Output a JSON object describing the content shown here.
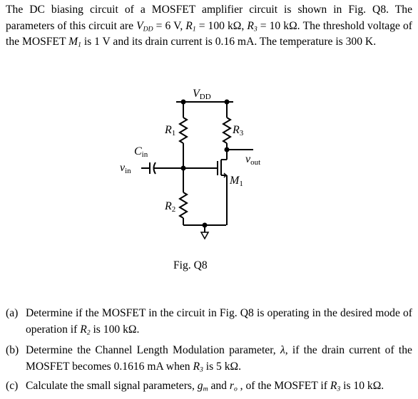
{
  "intro": [
    {
      "t": "The DC biasing circuit of a MOSFET amplifier circuit is shown in Fig. Q8. The parameters of this circuit are "
    },
    {
      "t": "V",
      "i": true
    },
    {
      "t": "DD",
      "i": true,
      "sub": true
    },
    {
      "t": " = 6 V, "
    },
    {
      "t": "R",
      "i": true
    },
    {
      "t": "1",
      "i": true,
      "sub": true
    },
    {
      "t": " = 100 kΩ, "
    },
    {
      "t": "R",
      "i": true
    },
    {
      "t": "3",
      "i": true,
      "sub": true
    },
    {
      "t": " = 10 kΩ. The threshold voltage of the MOSFET "
    },
    {
      "t": "M",
      "i": true
    },
    {
      "t": "1",
      "i": true,
      "sub": true
    },
    {
      "t": " is 1 V and its drain current is 0.16 mA. The temperature is 300 K."
    }
  ],
  "circuit": {
    "vdd": "V",
    "vdd_sub": "DD",
    "r1": "R",
    "r1_sub": "1",
    "r2": "R",
    "r2_sub": "2",
    "r3": "R",
    "r3_sub": "3",
    "cin": "C",
    "cin_sub": "in",
    "vin": "v",
    "vin_sub": "in",
    "vout": "v",
    "vout_sub": "out",
    "m1": "M",
    "m1_sub": "1"
  },
  "caption": "Fig. Q8",
  "questions": [
    {
      "label": "(a)",
      "parts": [
        {
          "t": "Determine if the MOSFET in the circuit in Fig. Q8 is operating in the desired mode of operation if "
        },
        {
          "t": "R",
          "i": true
        },
        {
          "t": "2",
          "i": true,
          "sub": true
        },
        {
          "t": " is 100 kΩ."
        }
      ]
    },
    {
      "label": "(b)",
      "parts": [
        {
          "t": "Determine the Channel Length Modulation parameter, "
        },
        {
          "t": "λ",
          "i": true
        },
        {
          "t": ", if the drain current of the MOSFET becomes 0.1616 mA when "
        },
        {
          "t": "R",
          "i": true
        },
        {
          "t": "3",
          "i": true,
          "sub": true
        },
        {
          "t": " is 5 kΩ."
        }
      ]
    },
    {
      "label": "(c)",
      "parts": [
        {
          "t": "Calculate the small signal parameters, "
        },
        {
          "t": "g",
          "i": true
        },
        {
          "t": "m",
          "i": true,
          "sub": true
        },
        {
          "t": " and "
        },
        {
          "t": "r",
          "i": true
        },
        {
          "t": "o",
          "i": true,
          "sub": true
        },
        {
          "t": " , of the MOSFET if "
        },
        {
          "t": "R",
          "i": true
        },
        {
          "t": "3",
          "i": true,
          "sub": true
        },
        {
          "t": " is 10 kΩ."
        }
      ]
    }
  ]
}
